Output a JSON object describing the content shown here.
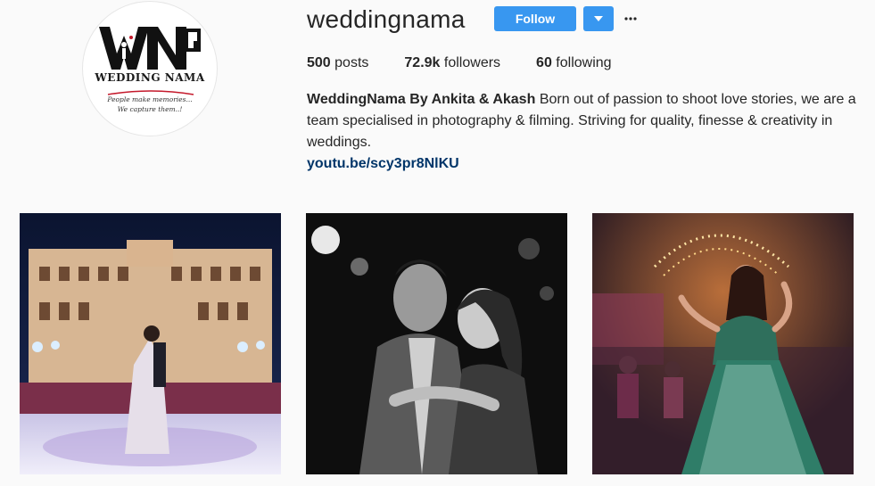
{
  "profile": {
    "avatar": {
      "brand_name": "WEDDING NAMA",
      "tagline_line1": "People make memories...",
      "tagline_line2": "We capture them..!"
    },
    "username": "weddingnama",
    "follow_label": "Follow",
    "dropdown_icon": "triangle-down-icon",
    "more_icon": "ellipsis-icon",
    "accent_color": "#3897f0"
  },
  "stats": {
    "posts_count": "500",
    "posts_label": "posts",
    "followers_count": "72.9k",
    "followers_label": "followers",
    "following_count": "60",
    "following_label": "following"
  },
  "bio": {
    "name": "WeddingNama By Ankita & Akash",
    "text": "Born out of passion to shoot love stories, we are a team specialised in photography & filming. Striving for quality, finesse & creativity in weddings.",
    "link": "youtu.be/scy3pr8NlKU"
  },
  "posts": [
    {
      "subject": "couple dancing before illuminated palace at night"
    },
    {
      "subject": "black and white couple portrait"
    },
    {
      "subject": "bride dancing in green lehenga under lights"
    }
  ]
}
